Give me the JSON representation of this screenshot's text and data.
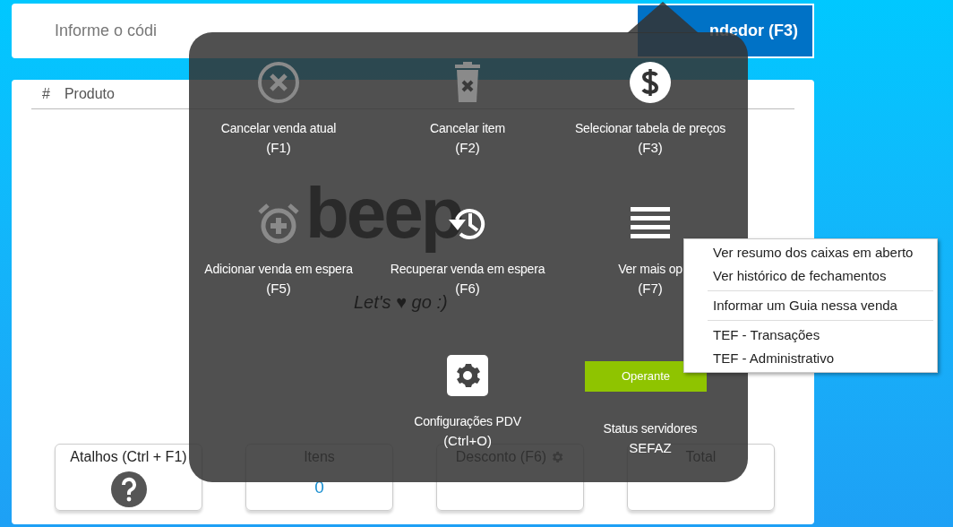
{
  "search": {
    "placeholder": "Informe o códi"
  },
  "seller_button": {
    "label": "ndedor (F3)"
  },
  "table": {
    "columns": [
      "#",
      "Produto"
    ]
  },
  "summary_cards": [
    {
      "label": "Atalhos (Ctrl + F1)",
      "kind": "help"
    },
    {
      "label": "Itens",
      "kind": "value",
      "value": "0"
    },
    {
      "label": "Desconto (F6)",
      "kind": "settings"
    },
    {
      "label": "Total",
      "kind": "value"
    }
  ],
  "logo": {
    "text": "beep",
    "tagline": "Let's ♥ go  :)"
  },
  "actions": [
    {
      "kind": "action",
      "label": "Cancelar venda atual",
      "shortcut": "(F1)",
      "disabled": true
    },
    {
      "kind": "action",
      "label": "Cancelar item",
      "shortcut": "(F2)",
      "disabled": true
    },
    {
      "kind": "action",
      "label": "Selecionar tabela de preços",
      "shortcut": "(F3)",
      "disabled": false
    },
    {
      "kind": "action",
      "label": "Adicionar venda em espera",
      "shortcut": "(F5)",
      "disabled": true
    },
    {
      "kind": "action",
      "label": "Recuperar venda em espera",
      "shortcut": "(F6)",
      "disabled": false
    },
    {
      "kind": "action",
      "label": "Ver mais op",
      "shortcut": "(F7)",
      "disabled": false
    },
    {
      "kind": "empty"
    },
    {
      "kind": "action",
      "label": "Configurações PDV",
      "shortcut": "(Ctrl+O)",
      "disabled": false
    },
    {
      "kind": "status",
      "label": "Status servidores",
      "shortcut": "SEFAZ",
      "status": "Operante",
      "color": "#8fc400"
    }
  ],
  "context_menu": {
    "groups": [
      [
        "Ver resumo dos caixas em aberto",
        "Ver histórico de fechamentos"
      ],
      [
        "Informar um Guia nessa venda"
      ],
      [
        "TEF - Transações",
        "TEF - Administrativo"
      ]
    ]
  }
}
